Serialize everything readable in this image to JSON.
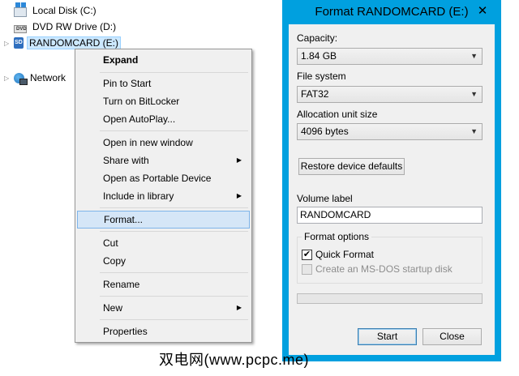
{
  "tree": [
    {
      "label": "Local Disk (C:)",
      "icon": "system-drive-icon"
    },
    {
      "label": "DVD RW Drive (D:)",
      "icon": "dvd-drive-icon",
      "icon_text": "DVD"
    },
    {
      "label": "RANDOMCARD (E:)",
      "icon": "sd-card-icon",
      "icon_text": "SD"
    },
    {
      "label": "Network",
      "icon": "network-icon"
    }
  ],
  "context_menu": {
    "items": [
      "Expand",
      "Pin to Start",
      "Turn on BitLocker",
      "Open AutoPlay...",
      "Open in new window",
      "Share with",
      "Open as Portable Device",
      "Include in library",
      "Format...",
      "Cut",
      "Copy",
      "Rename",
      "New",
      "Properties"
    ],
    "submenu_glyph": "▶"
  },
  "dialog": {
    "title": "Format RANDOMCARD (E:)",
    "close_glyph": "✕",
    "capacity_label": "Capacity:",
    "capacity_value": "1.84 GB",
    "filesystem_label": "File system",
    "filesystem_value": "FAT32",
    "allocation_label": "Allocation unit size",
    "allocation_value": "4096 bytes",
    "restore_label": "Restore device defaults",
    "volume_label": "Volume label",
    "volume_value": "RANDOMCARD",
    "format_options_label": "Format options",
    "quick_format_label": "Quick Format",
    "quick_format_checked": true,
    "msdos_label": "Create an MS-DOS startup disk",
    "msdos_checked": false,
    "progress": 0,
    "start_label": "Start",
    "close_label": "Close",
    "accent_color": "#00a0df"
  },
  "watermark": "双电网(www.pcpc.me)"
}
